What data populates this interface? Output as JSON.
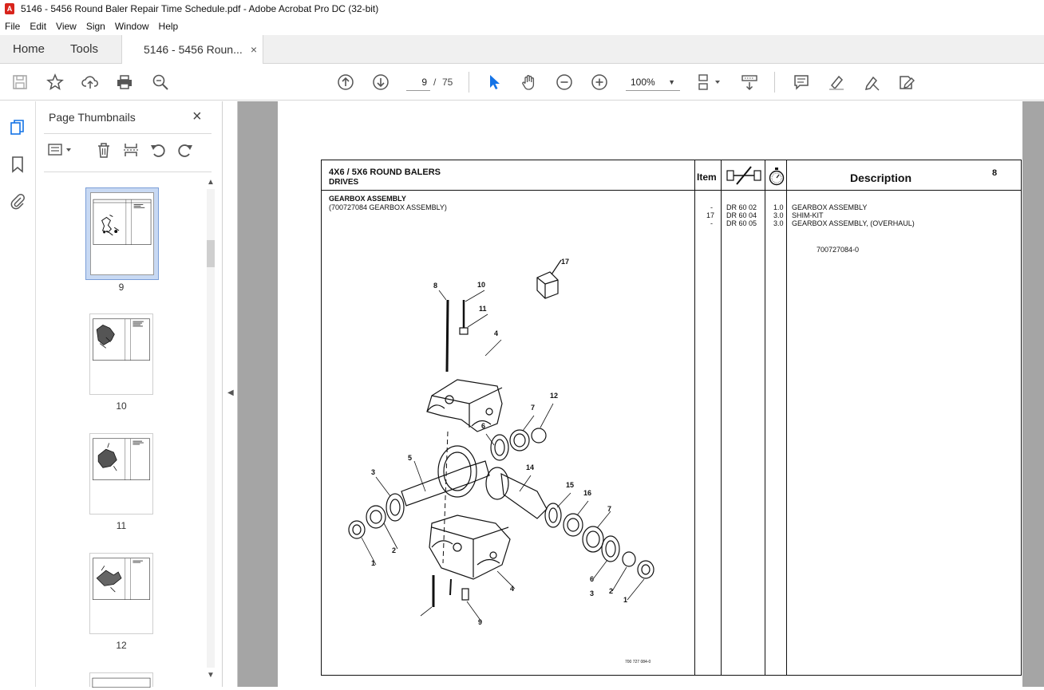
{
  "window": {
    "title": "5146 - 5456 Round Baler Repair Time Schedule.pdf - Adobe Acrobat Pro DC (32-bit)"
  },
  "menu": [
    "File",
    "Edit",
    "View",
    "Sign",
    "Window",
    "Help"
  ],
  "tabs": {
    "home": "Home",
    "tools": "Tools",
    "document": "5146 - 5456 Roun...",
    "close": "×"
  },
  "toolbar": {
    "current_page": "9",
    "page_separator": "/",
    "total_pages": "75",
    "zoom": "100%"
  },
  "panel": {
    "title": "Page Thumbnails",
    "close": "×",
    "thumbnails": [
      {
        "label": "9",
        "selected": true
      },
      {
        "label": "10",
        "selected": false
      },
      {
        "label": "11",
        "selected": false
      },
      {
        "label": "12",
        "selected": false
      }
    ]
  },
  "document": {
    "header": {
      "title": "4X6 / 5X6 ROUND BALERS",
      "subtitle": "DRIVES",
      "item_col": "Item",
      "desc_col": "Description",
      "page_num": "8"
    },
    "section": {
      "title": "GEARBOX ASSEMBLY",
      "subtitle": "(700727084 GEARBOX ASSEMBLY)"
    },
    "rows": [
      {
        "item": "-",
        "code": "DR 60 02",
        "time": "1.0",
        "desc": "GEARBOX ASSEMBLY"
      },
      {
        "item": "17",
        "code": "DR 60 04",
        "time": "3.0",
        "desc": "SHIM-KIT"
      },
      {
        "item": "-",
        "code": "DR 60 05",
        "time": "3.0",
        "desc": "GEARBOX ASSEMBLY,  (OVERHAUL)"
      }
    ],
    "part_code": "700727084-0",
    "figure_id": "700 727 084-0",
    "callouts": [
      "17",
      "8",
      "10",
      "11",
      "4",
      "12",
      "7",
      "6",
      "5",
      "14",
      "3",
      "15",
      "16",
      "7",
      "2",
      "1",
      "4",
      "9",
      "6",
      "3",
      "2",
      "1"
    ]
  },
  "colors": {
    "accent": "#1473e6",
    "doc_bg": "#a5a5a5",
    "selected_thumb": "#c8d9f3"
  }
}
